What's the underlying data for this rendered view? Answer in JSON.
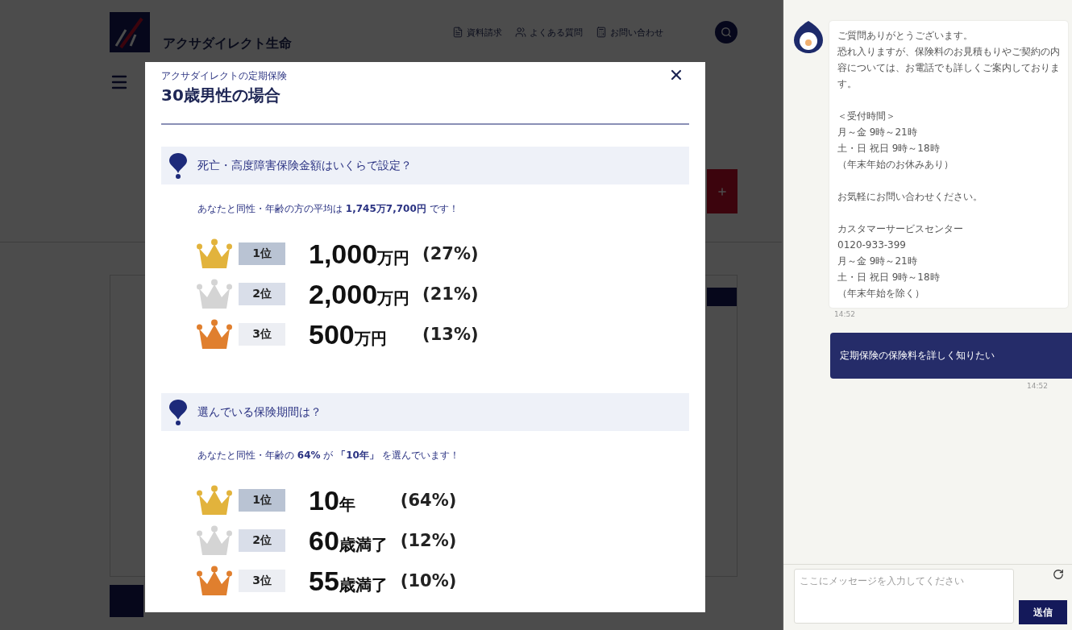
{
  "header": {
    "brand": "アクサダイレクト生命",
    "nav": [
      {
        "label": "資料請求"
      },
      {
        "label": "よくある質問"
      },
      {
        "label": "お問い合わせ"
      }
    ]
  },
  "modal": {
    "subtitle": "アクサダイレクトの定期保険",
    "title": "30歳男性の場合",
    "sections": [
      {
        "question": "死亡・高度障害保険金額はいくらで設定？",
        "summary": "あなたと同性・年齢の方の平均は **1,745万7,700円** です！",
        "ranking": [
          {
            "rank": "1位",
            "color": "#e2b33c",
            "amount": "1,000",
            "unit": "万円",
            "share": "(27%)"
          },
          {
            "rank": "2位",
            "color": "#d4d4d4",
            "amount": "2,000",
            "unit": "万円",
            "share": "(21%)"
          },
          {
            "rank": "3位",
            "color": "#e07f2e",
            "amount": "500",
            "unit": "万円",
            "share": "(13%)"
          }
        ]
      },
      {
        "question": "選んでいる保険期間は？",
        "summary": "あなたと同性・年齢の **64%** が **「10年」** を選んでいます！",
        "ranking": [
          {
            "rank": "1位",
            "color": "#e2b33c",
            "amount": "10",
            "unit": "年",
            "share": "(64%)"
          },
          {
            "rank": "2位",
            "color": "#d4d4d4",
            "amount": "60",
            "unit": "歳満了",
            "share": "(12%)"
          },
          {
            "rank": "3位",
            "color": "#e07f2e",
            "amount": "55",
            "unit": "歳満了",
            "share": "(10%)"
          }
        ]
      }
    ]
  },
  "chat": {
    "messages": [
      {
        "kind": "operator",
        "paragraphs": [
          [
            "ご質問ありがとうございます。",
            "恐れ入りますが、保険料のお見積もりやご契約の内容については、お電話でも詳しくご案内しております。"
          ],
          [
            "＜受付時間＞",
            "月～金 9時～21時",
            "土・日 祝日 9時～18時",
            "（年末年始のお休みあり）"
          ],
          [
            "お気軽にお問い合わせください。"
          ],
          [
            "カスタマーサービスセンター",
            "0120-933-399",
            "月～金 9時～21時",
            "土・日 祝日 9時～18時",
            "（年末年始を除く）"
          ]
        ],
        "time": "14:52"
      },
      {
        "kind": "user",
        "text": "定期保険の保険料を詳しく知りたい",
        "time": "14:52"
      }
    ],
    "input": {
      "placeholder": "ここにメッセージを入力してください"
    },
    "send_button": "送信"
  }
}
